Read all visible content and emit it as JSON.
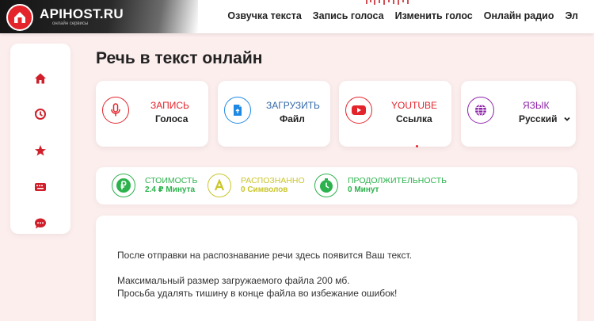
{
  "header": {
    "logo_name": "APIHOST.RU",
    "logo_sub": "онлайн сервисы",
    "nav": [
      "Озвучка текста",
      "Запись голоса",
      "Изменить голос",
      "Онлайн радио",
      "Эл"
    ]
  },
  "sidebar": {
    "items": [
      {
        "icon": "home-icon"
      },
      {
        "icon": "history-icon"
      },
      {
        "icon": "star-icon"
      },
      {
        "icon": "keyboard-icon"
      },
      {
        "icon": "chat-icon"
      }
    ]
  },
  "page": {
    "title": "Речь в текст онлайн"
  },
  "cards": [
    {
      "title": "ЗАПИСЬ",
      "subtitle": "Голоса",
      "icon": "microphone-icon",
      "color": "#e3242b"
    },
    {
      "title": "ЗАГРУЗИТЬ",
      "subtitle": "Файл",
      "icon": "file-upload-icon",
      "color": "#1e88e5"
    },
    {
      "title": "YOUTUBE",
      "subtitle": "Ссылка",
      "icon": "youtube-icon",
      "color": "#e3242b"
    },
    {
      "title": "ЯЗЫК",
      "subtitle": "Русский",
      "icon": "globe-icon",
      "color": "#8e24aa"
    }
  ],
  "stats": [
    {
      "label": "СТОИМОСТЬ",
      "value": "2.4 ₽ Минута",
      "icon": "ruble-icon",
      "color": "#2bb24c"
    },
    {
      "label": "РАСПОЗНАННО",
      "value": "0 Символов",
      "icon": "letter-a-icon",
      "color": "#c9c62a"
    },
    {
      "label": "ПРОДОЛЖИТЕЛЬНОСТЬ",
      "value": "0 Минут",
      "icon": "stopwatch-icon",
      "color": "#2bb24c"
    }
  ],
  "textbox": {
    "line1": "После отправки на распознавание речи здесь появится Ваш текст.",
    "line2": "Максимальный размер загружаемого файла 200 мб.",
    "line3": "Просьба удалять тишину в конце файла во избежание ошибок!"
  },
  "colors": {
    "accent": "#e3242b",
    "background": "#fdeeee"
  }
}
